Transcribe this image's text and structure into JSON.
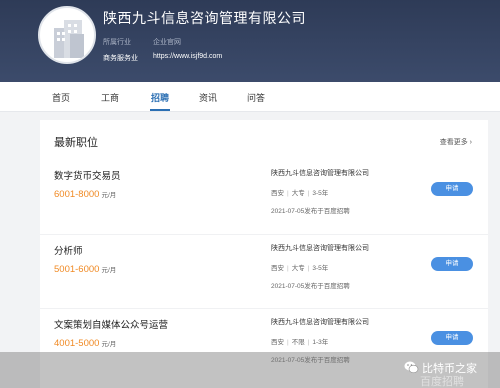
{
  "company": {
    "name": "陕西九斗信息咨询管理有限公司",
    "industry_label": "所属行业",
    "industry_value": "商务服务业",
    "website_label": "企业官网",
    "website_value": "https://www.isjf9d.com"
  },
  "tabs": [
    {
      "label": "首页",
      "active": false
    },
    {
      "label": "工商",
      "active": false
    },
    {
      "label": "招聘",
      "active": true
    },
    {
      "label": "资讯",
      "active": false
    },
    {
      "label": "问答",
      "active": false
    }
  ],
  "section": {
    "title": "最新职位",
    "view_more": "查看更多 ›"
  },
  "jobs": [
    {
      "title": "数字货币交易员",
      "salary": "6001-8000",
      "salary_unit": "元/月",
      "company": "陕西九斗信息咨询管理有限公司",
      "city": "西安",
      "education": "大专",
      "experience": "3-5年",
      "date": "2021-07-05发布于百度招聘",
      "apply_label": "申请"
    },
    {
      "title": "分析师",
      "salary": "5001-6000",
      "salary_unit": "元/月",
      "company": "陕西九斗信息咨询管理有限公司",
      "city": "西安",
      "education": "大专",
      "experience": "3-5年",
      "date": "2021-07-05发布于百度招聘",
      "apply_label": "申请"
    },
    {
      "title": "文案策划自媒体公众号运营",
      "salary": "4001-5000",
      "salary_unit": "元/月",
      "company": "陕西九斗信息咨询管理有限公司",
      "city": "西安",
      "education": "不限",
      "experience": "1-3年",
      "date": "2021-07-05发布于百度招聘",
      "apply_label": "申请"
    }
  ],
  "watermark": {
    "line1": "比特币之家",
    "line2": "百度招聘"
  },
  "colors": {
    "header_bg": "#2e3b57",
    "accent": "#2b6fb3",
    "salary": "#f08a24",
    "apply_button": "#4a90e2"
  }
}
